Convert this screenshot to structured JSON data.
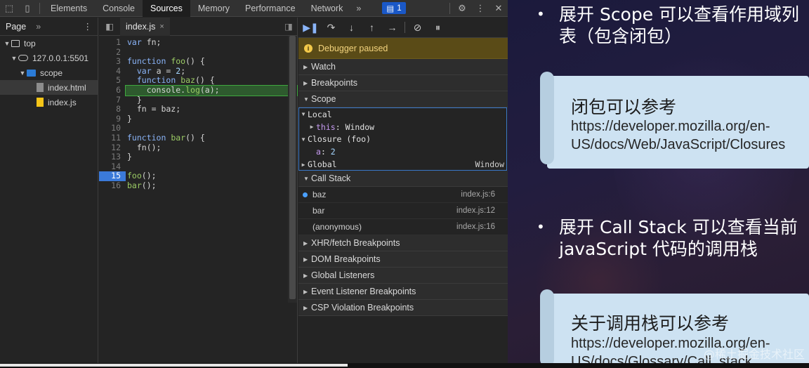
{
  "devtools": {
    "tabs": [
      "Elements",
      "Console",
      "Sources",
      "Memory",
      "Performance",
      "Network"
    ],
    "active_tab": "Sources",
    "more_tabs": "»",
    "message_count": "1",
    "navigator": {
      "tab_label": "Page",
      "more": "»",
      "tree": [
        {
          "label": "top",
          "depth": 0,
          "icon": "frame-icon",
          "expanded": true
        },
        {
          "label": "127.0.0.1:5501",
          "depth": 1,
          "icon": "cloud-icon",
          "expanded": true
        },
        {
          "label": "scope",
          "depth": 2,
          "icon": "folder-icon",
          "expanded": true
        },
        {
          "label": "index.html",
          "depth": 3,
          "icon": "html-file-icon",
          "selected": true
        },
        {
          "label": "index.js",
          "depth": 3,
          "icon": "js-file-icon"
        }
      ]
    },
    "editor": {
      "open_file": "index.js",
      "close": "×",
      "paused_line": 6,
      "breakpoint_line": 15,
      "lines": [
        "var fn;",
        "",
        "function foo() {",
        "  var a = 2;",
        "  function baz() {",
        "    console.log(a);",
        "  }",
        "  fn = baz;",
        "}",
        "",
        "function bar() {",
        "  fn();",
        "}",
        "",
        "foo();",
        "bar();"
      ]
    },
    "debugger": {
      "paused_text": "Debugger paused",
      "sections_top": [
        "Watch",
        "Breakpoints"
      ],
      "scope_label": "Scope",
      "scope": {
        "local_label": "Local",
        "this_key": "this",
        "this_value": "Window",
        "closure_label": "Closure (foo)",
        "closure_var_key": "a",
        "closure_var_value": "2",
        "global_label": "Global",
        "global_value": "Window"
      },
      "call_stack_label": "Call Stack",
      "call_stack": [
        {
          "name": "baz",
          "location": "index.js:6",
          "current": true
        },
        {
          "name": "bar",
          "location": "index.js:12"
        },
        {
          "name": "(anonymous)",
          "location": "index.js:16"
        }
      ],
      "sections_bottom": [
        "XHR/fetch Breakpoints",
        "DOM Breakpoints",
        "Global Listeners",
        "Event Listener Breakpoints",
        "CSP Violation Breakpoints"
      ]
    }
  },
  "slide": {
    "bullet1": [
      "展开 Scope 可以查看作用域列",
      "表（包含闭包）"
    ],
    "note1": {
      "title": "闭包可以参考",
      "link": [
        "https://developer.mozilla.org/en-",
        "US/docs/Web/JavaScript/Closures"
      ]
    },
    "bullet2": [
      "展开 Call Stack 可以查看当前",
      "javaScript 代码的调用栈"
    ],
    "note2": {
      "title": "关于调用栈可以参考",
      "link": [
        "https://developer.mozilla.org/en-",
        "US/docs/Glossary/Call_stack"
      ]
    },
    "watermark": "@稀土掘金技术社区"
  },
  "video": {
    "progress_fraction": 0.43
  },
  "colors": {
    "accent": "#3b7ad9",
    "paused_banner": "#5a4b17",
    "note_bg": "#cde2f2"
  }
}
